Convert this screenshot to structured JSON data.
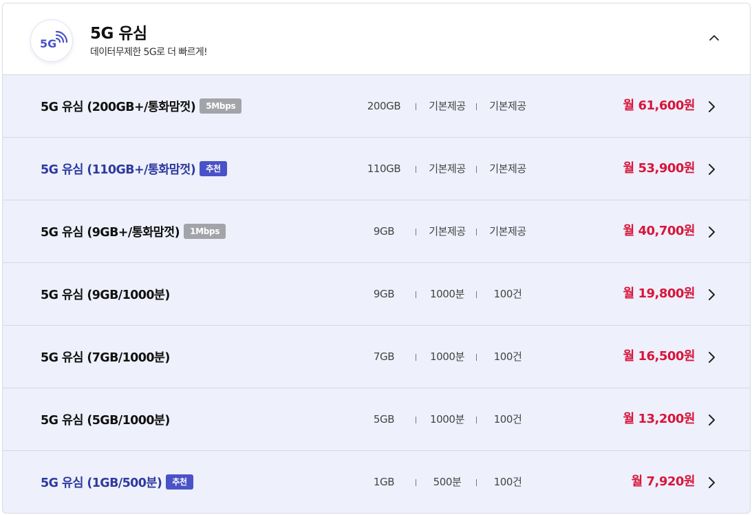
{
  "header": {
    "badge_icon": "5g-signal-icon",
    "title": "5G 유심",
    "subtitle": "데이터무제한 5G로 더 빠르게!",
    "toggle_icon": "chevron-up-icon"
  },
  "colors": {
    "accent": "#4a52c7",
    "recommended_text": "#2d3a9e",
    "price": "#d8153b",
    "row_bg": "#eef0fb"
  },
  "plans": [
    {
      "name": "5G 유심 (200GB+/통화맘껏)",
      "badge": "5Mbps",
      "data": "200GB",
      "voice": "기본제공",
      "sms": "기본제공",
      "price": "월 61,600원"
    },
    {
      "name": "5G 유심 (110GB+/통화맘껏)",
      "badge": "추천",
      "data": "110GB",
      "voice": "기본제공",
      "sms": "기본제공",
      "price": "월 53,900원"
    },
    {
      "name": "5G 유심 (9GB+/통화맘껏)",
      "badge": "1Mbps",
      "data": "9GB",
      "voice": "기본제공",
      "sms": "기본제공",
      "price": "월 40,700원"
    },
    {
      "name": "5G 유심 (9GB/1000분)",
      "badge": "",
      "data": "9GB",
      "voice": "1000분",
      "sms": "100건",
      "price": "월 19,800원"
    },
    {
      "name": "5G 유심 (7GB/1000분)",
      "badge": "",
      "data": "7GB",
      "voice": "1000분",
      "sms": "100건",
      "price": "월 16,500원"
    },
    {
      "name": "5G 유심 (5GB/1000분)",
      "badge": "",
      "data": "5GB",
      "voice": "1000분",
      "sms": "100건",
      "price": "월 13,200원"
    },
    {
      "name": "5G 유심 (1GB/500분)",
      "badge": "추천",
      "data": "1GB",
      "voice": "500분",
      "sms": "100건",
      "price": "월 7,920원"
    }
  ]
}
